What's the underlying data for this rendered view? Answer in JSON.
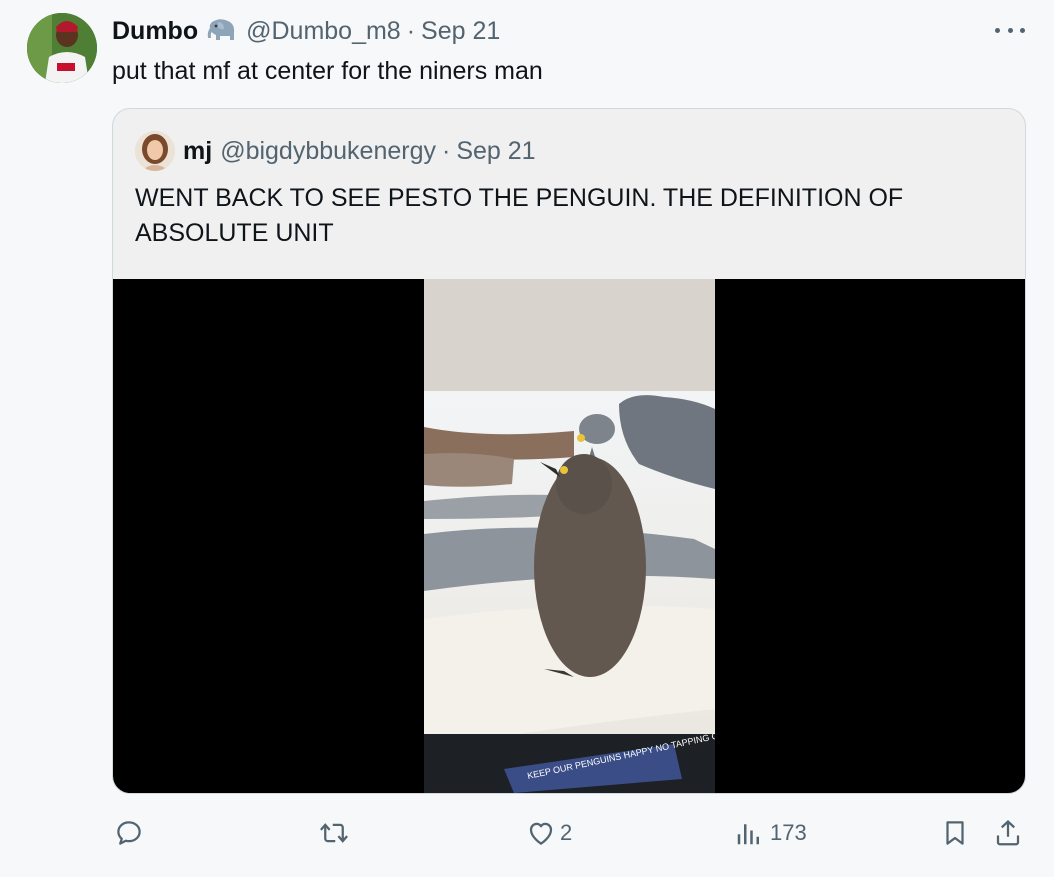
{
  "tweet": {
    "author_name": "Dumbo",
    "author_emoji": "elephant-emoji",
    "handle": "@Dumbo_m8",
    "separator": "·",
    "date": "Sep 21",
    "text": "put that mf at center for the niners man"
  },
  "quoted": {
    "author_name": "mj",
    "handle": "@bigdybbukenergy",
    "separator": "·",
    "date": "Sep 21",
    "text": "WENT BACK TO SEE PESTO THE PENGUIN. THE DEFINITION OF ABSOLUTE UNIT",
    "media_sign": "KEEP OUR PENGUINS HAPPY NO TAPPING GLASS"
  },
  "actions": {
    "reply_count": "",
    "retweet_count": "",
    "like_count": "2",
    "views_count": "173"
  },
  "icons": [
    "more-icon",
    "reply-icon",
    "retweet-icon",
    "like-icon",
    "views-icon",
    "bookmark-icon",
    "share-icon"
  ],
  "colors": {
    "background": "#f7f8f9",
    "muted": "#536471",
    "border": "#cfd9de"
  }
}
